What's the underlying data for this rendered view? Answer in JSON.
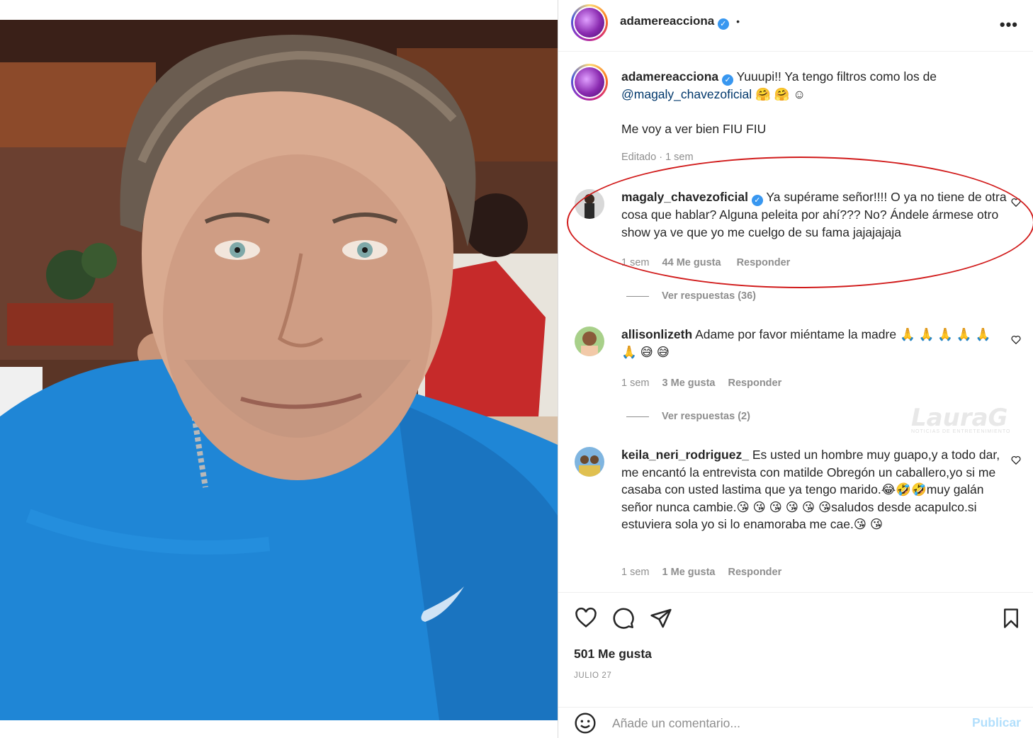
{
  "post": {
    "author": "adamereacciona",
    "header_dot": "•",
    "caption_line1": "Yuuupi!! Ya tengo filtros como los de",
    "caption_mention": "@magaly_chavezoficial",
    "caption_emoji": "🤗 🤗 ☺",
    "caption_line2": "Me voy a ver bien FIU FIU",
    "caption_meta": "Editado · 1 sem"
  },
  "comments": [
    {
      "user": "magaly_chavezoficial",
      "verified": true,
      "text": "Ya supérame señor!!!! O ya no tiene de otra cosa que hablar? Alguna peleita por ahí??? No? Ándele ármese otro show ya ve que yo me cuelgo de su fama jajajajaja",
      "time": "1 sem",
      "likes": "44 Me gusta",
      "reply": "Responder",
      "replies": "Ver respuestas (36)"
    },
    {
      "user": "allisonlizeth",
      "verified": false,
      "text": "Adame por favor miéntame la madre 🙏 🙏 🙏 🙏 🙏 🙏 😅 😅",
      "time": "1 sem",
      "likes": "3 Me gusta",
      "reply": "Responder",
      "replies": "Ver respuestas (2)"
    },
    {
      "user": "keila_neri_rodriguez_",
      "verified": false,
      "text": "Es usted un hombre muy guapo,y a todo dar, me encantó la entrevista con matilde Obregón un caballero,yo si me casaba con usted lastima que ya tengo marido.😂🤣🤣muy galán señor nunca cambie.😘 😘 😘 😘 😘 😘saludos desde acapulco.si estuviera sola yo si lo enamoraba me cae.😘 😘",
      "time": "1 sem",
      "likes": "1 Me gusta",
      "reply": "Responder"
    }
  ],
  "actions": {
    "like_icon": "heart-icon",
    "comment_icon": "comment-icon",
    "share_icon": "paper-plane-icon",
    "save_icon": "bookmark-icon",
    "likes": "501 Me gusta",
    "date": "JULIO 27"
  },
  "add_comment": {
    "placeholder": "Añade un comentario...",
    "publish": "Publicar"
  },
  "watermark": {
    "brand": "LauraG",
    "tagline": "NOTICIAS DE ENTRETENIMIENTO"
  },
  "colors": {
    "annotation_ellipse": "#d11b1b",
    "verified": "#3897f0",
    "mention": "#00376b",
    "publish_disabled": "#b2dffc"
  }
}
